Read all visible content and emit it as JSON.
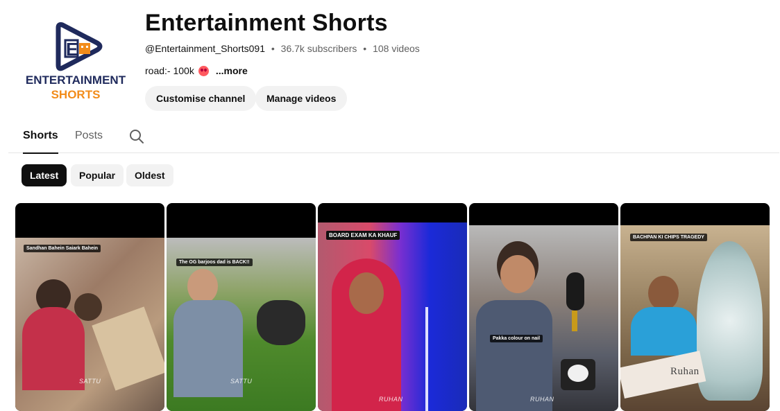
{
  "channel": {
    "name": "Entertainment Shorts",
    "handle": "@Entertainment_Shorts091",
    "subscribers": "36.7k subscribers",
    "videos": "108 videos",
    "separator": "•",
    "description": "road:- 100k",
    "description_emoji": "heart-eyes-emoji",
    "more_label": "...more",
    "logo": {
      "line1": "ENTERTAINMENT",
      "line2": "SHORTS",
      "mark": "E"
    }
  },
  "actions": {
    "customise_label": "Customise channel",
    "manage_label": "Manage videos"
  },
  "tabs": [
    {
      "label": "Shorts",
      "active": true
    },
    {
      "label": "Posts",
      "active": false
    }
  ],
  "search_icon": "search-icon",
  "chips": [
    {
      "label": "Latest",
      "active": true
    },
    {
      "label": "Popular",
      "active": false
    },
    {
      "label": "Oldest",
      "active": false
    }
  ],
  "shorts": [
    {
      "caption": "Sandhan Bahein Saiark Bahein",
      "watermark": "SATTU"
    },
    {
      "caption": "The OG barjoos dad is BACK!!",
      "watermark": "SATTU"
    },
    {
      "caption": "BOARD EXAM KA KHAUF",
      "watermark": "RUHAN"
    },
    {
      "caption": "Pakka colour on nail",
      "watermark": "RUHAN"
    },
    {
      "caption": "BACHPAN KI CHIPS TRAGEDY",
      "watermark": "Ruhan"
    }
  ],
  "colors": {
    "brand_navy": "#1f2a5c",
    "brand_orange": "#f28c1a",
    "chip_active": "#0f0f0f",
    "chip_bg": "#f2f2f2"
  }
}
